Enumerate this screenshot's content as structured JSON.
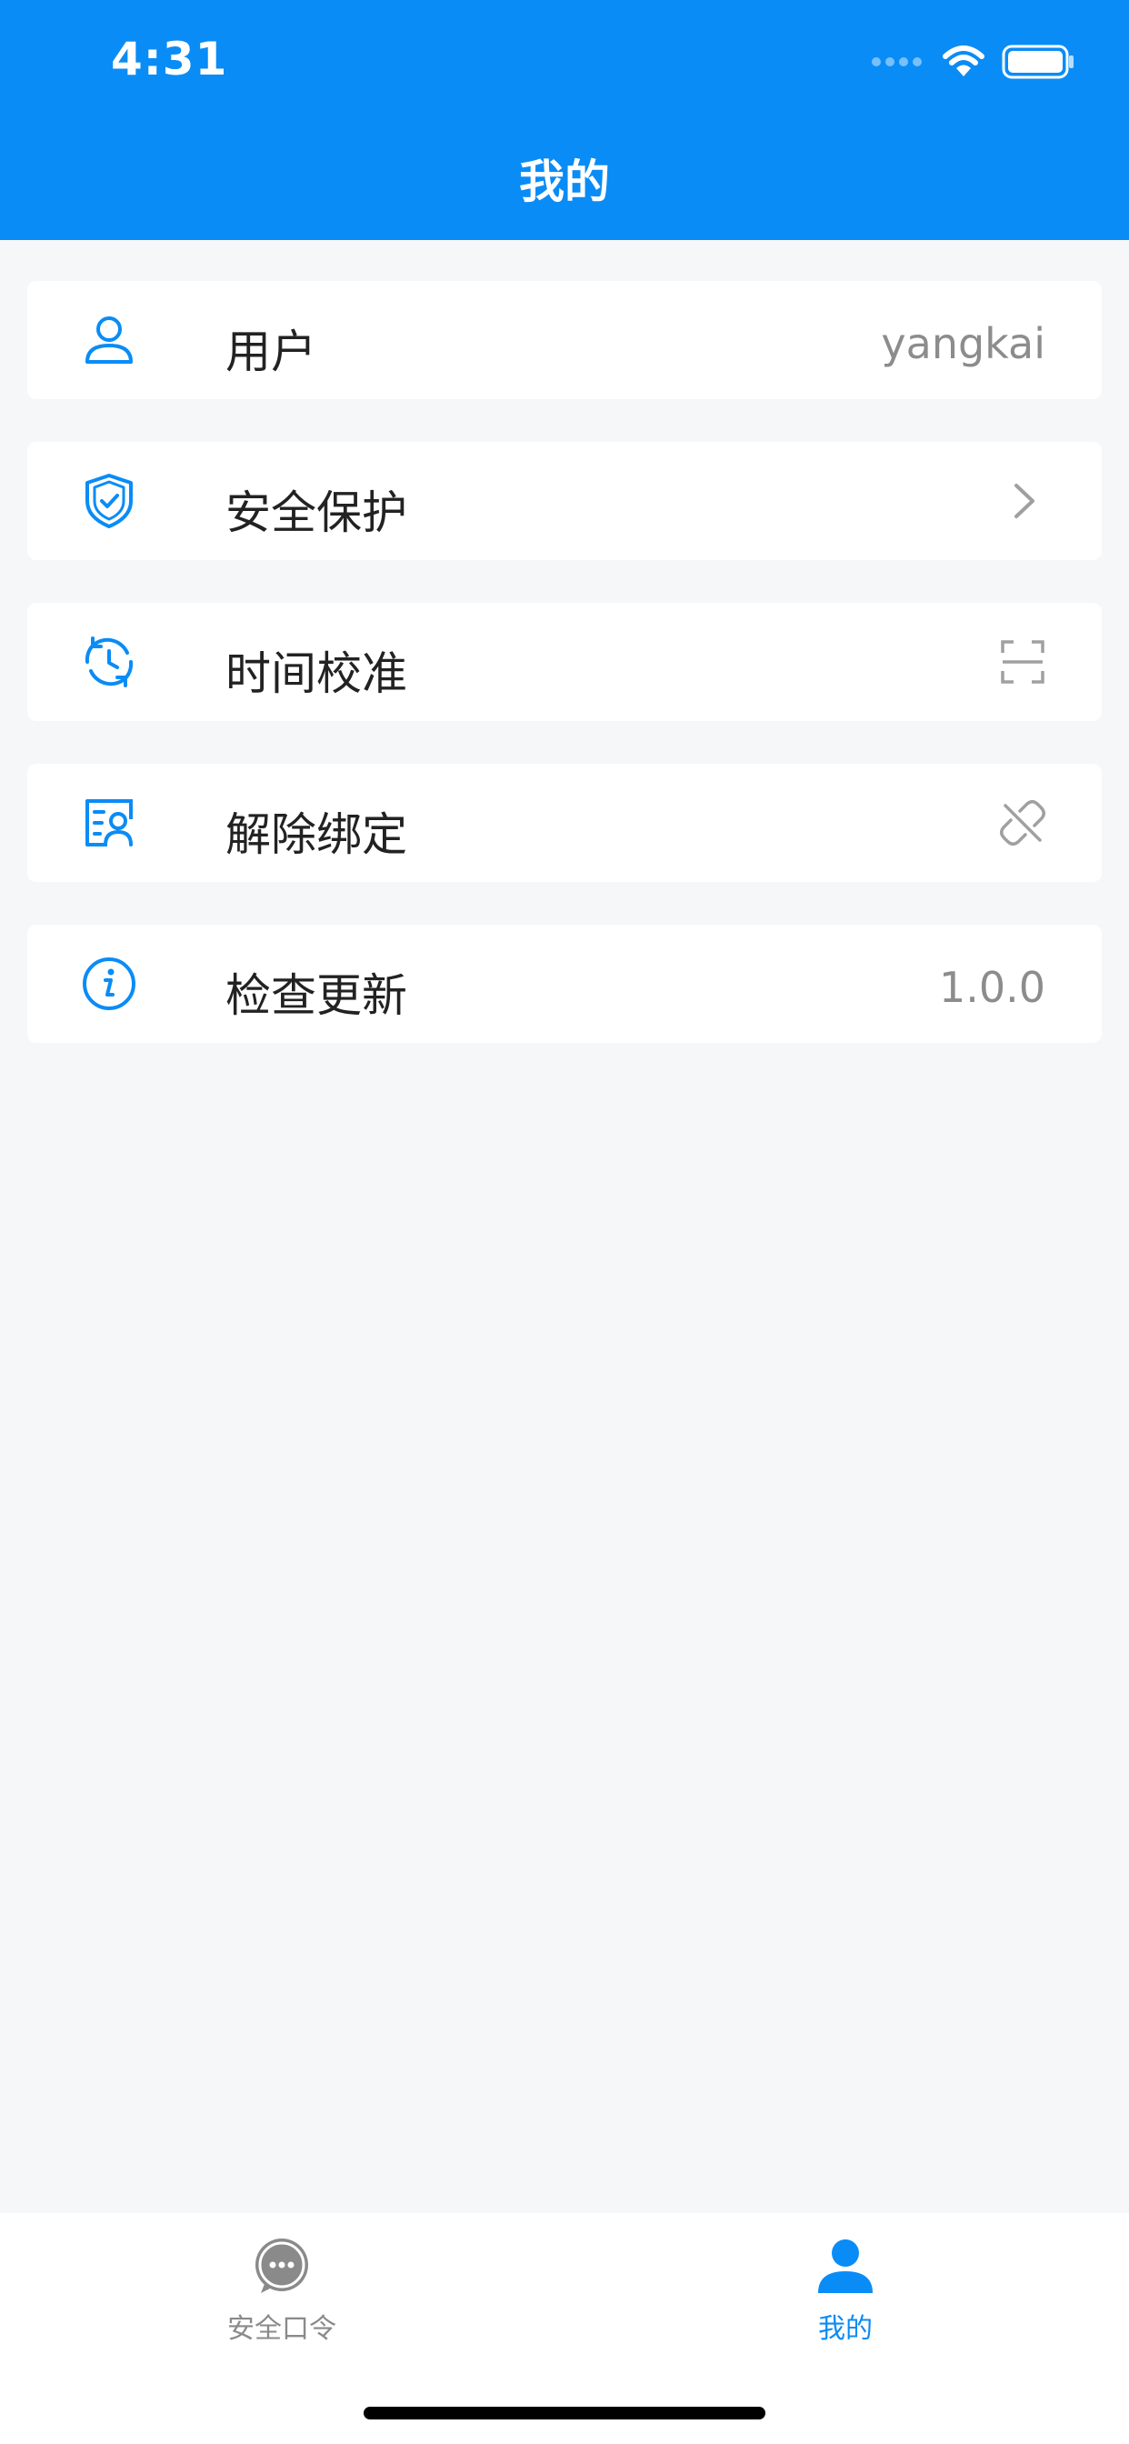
{
  "status_bar": {
    "time": "4:31"
  },
  "header": {
    "title": "我的"
  },
  "menu": {
    "items": [
      {
        "icon": "user-icon",
        "label": "用户",
        "value": "yangkai"
      },
      {
        "icon": "shield-icon",
        "label": "安全保护",
        "right_icon": "chevron-right-icon"
      },
      {
        "icon": "clock-sync-icon",
        "label": "时间校准",
        "right_icon": "scan-frame-icon"
      },
      {
        "icon": "id-card-icon",
        "label": "解除绑定",
        "right_icon": "unlink-icon"
      },
      {
        "icon": "info-icon",
        "label": "检查更新",
        "value": "1.0.0"
      }
    ]
  },
  "tabbar": {
    "tabs": [
      {
        "label": "安全口令",
        "icon": "chat-dots-icon",
        "active": false
      },
      {
        "label": "我的",
        "icon": "person-icon",
        "active": true
      }
    ]
  },
  "colors": {
    "brand": "#0a8cf6",
    "background": "#f6f7f9",
    "muted": "#8c8c8c"
  }
}
